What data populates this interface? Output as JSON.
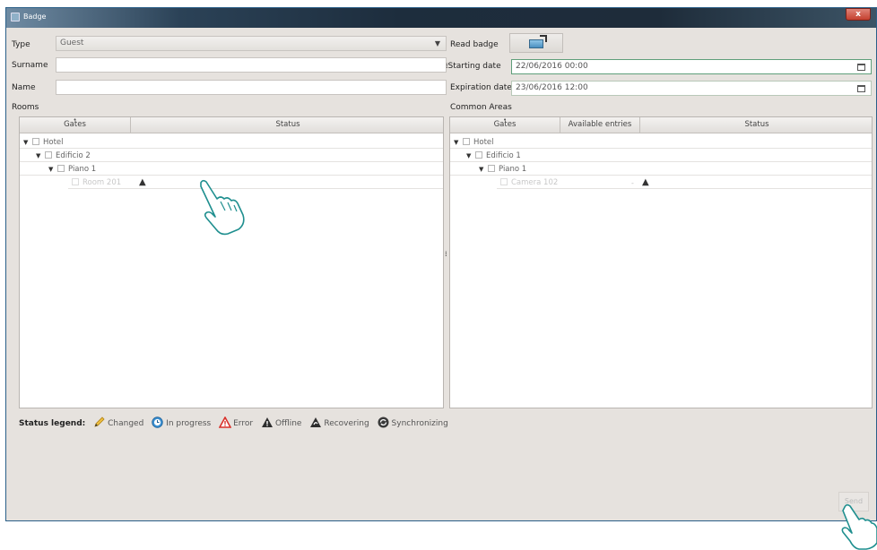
{
  "window": {
    "title": "Badge",
    "close_label": "x"
  },
  "form": {
    "type_label": "Type",
    "type_value": "Guest",
    "surname_label": "Surname",
    "surname_value": "",
    "name_label": "Name",
    "name_value": "",
    "read_badge_label": "Read badge",
    "starting_date_label": "Starting date",
    "starting_date_value": "22/06/2016 00:00",
    "expiration_date_label": "Expiration date",
    "expiration_date_value": "23/06/2016 12:00"
  },
  "rooms": {
    "section_label": "Rooms",
    "columns": [
      "Gates",
      "Status"
    ],
    "tree": [
      {
        "label": "Hotel",
        "level": 0
      },
      {
        "label": "Edificio 2",
        "level": 1
      },
      {
        "label": "Piano 1",
        "level": 2
      },
      {
        "label": "Room 201",
        "level": 3
      }
    ]
  },
  "common_areas": {
    "section_label": "Common Areas",
    "columns": [
      "Gates",
      "Available entries",
      "Status"
    ],
    "tree": [
      {
        "label": "Hotel",
        "level": 0
      },
      {
        "label": "Edificio 1",
        "level": 1
      },
      {
        "label": "Piano 1",
        "level": 2
      },
      {
        "label": "Camera 102",
        "level": 3,
        "entries": "-"
      }
    ]
  },
  "legend": {
    "title": "Status legend:",
    "items": [
      "Changed",
      "In progress",
      "Error",
      "Offline",
      "Recovering",
      "Synchronizing"
    ]
  },
  "actions": {
    "send_label": "Send"
  },
  "colors": {
    "window_bg": "#e6e2de",
    "titlebar": "#1e2c3a",
    "close": "#c4402f",
    "error": "#d9302a",
    "in_progress": "#3b8fd0",
    "changed": "#e8b830"
  },
  "icons": {
    "status_warning": "offline-warning-icon",
    "badge_reader": "badge-card-icon",
    "calendar": "calendar-icon"
  }
}
